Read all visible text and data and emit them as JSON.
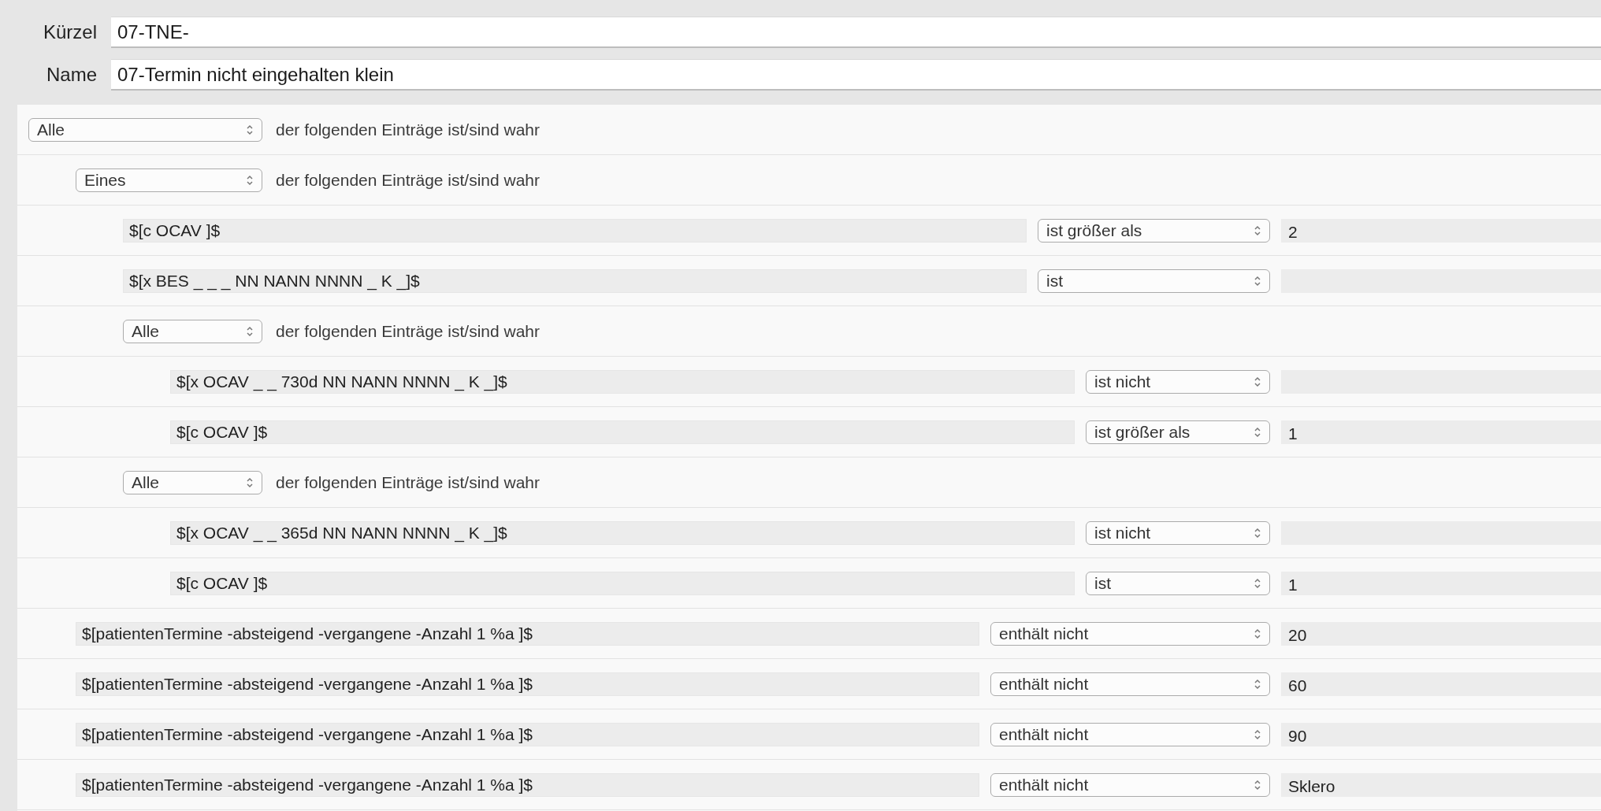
{
  "header": {
    "fields": [
      {
        "label": "Kürzel",
        "value": "07-TNE-"
      },
      {
        "label": "Name",
        "value": "07-Termin nicht eingehalten klein"
      }
    ]
  },
  "rules": {
    "kind": "group",
    "quantifier": "Alle",
    "text": "der folgenden Einträge ist/sind wahr",
    "children": [
      {
        "kind": "group",
        "quantifier": "Eines",
        "text": "der folgenden Einträge ist/sind wahr",
        "children": [
          {
            "kind": "condition",
            "field": "$[c OCAV ]$",
            "operator": "ist größer als",
            "value": "2"
          },
          {
            "kind": "condition",
            "field": "$[x BES _ _ _ NN NANN NNNN _ K _]$",
            "operator": "ist"
          },
          {
            "kind": "group",
            "quantifier": "Alle",
            "text": "der folgenden Einträge ist/sind wahr",
            "children": [
              {
                "kind": "condition",
                "field": "$[x OCAV _ _ 730d NN NANN NNNN _ K _]$",
                "operator": "ist nicht"
              },
              {
                "kind": "condition",
                "field": "$[c OCAV ]$",
                "operator": "ist größer als",
                "value": "1"
              }
            ]
          },
          {
            "kind": "group",
            "quantifier": "Alle",
            "text": "der folgenden Einträge ist/sind wahr",
            "children": [
              {
                "kind": "condition",
                "field": "$[x OCAV _ _ 365d NN NANN NNNN _ K _]$",
                "operator": "ist nicht"
              },
              {
                "kind": "condition",
                "field": "$[c OCAV ]$",
                "operator": "ist",
                "value": "1"
              }
            ]
          }
        ]
      },
      {
        "kind": "condition",
        "field": "$[patientenTermine -absteigend -vergangene -Anzahl 1 %a ]$",
        "operator": "enthält nicht",
        "value": "20"
      },
      {
        "kind": "condition",
        "field": "$[patientenTermine -absteigend -vergangene -Anzahl 1 %a ]$",
        "operator": "enthält nicht",
        "value": "60"
      },
      {
        "kind": "condition",
        "field": "$[patientenTermine -absteigend -vergangene -Anzahl 1 %a ]$",
        "operator": "enthält nicht",
        "value": "90"
      },
      {
        "kind": "condition",
        "field": "$[patientenTermine -absteigend -vergangene -Anzahl 1 %a ]$",
        "operator": "enthält nicht",
        "value": "Sklero"
      }
    ]
  }
}
